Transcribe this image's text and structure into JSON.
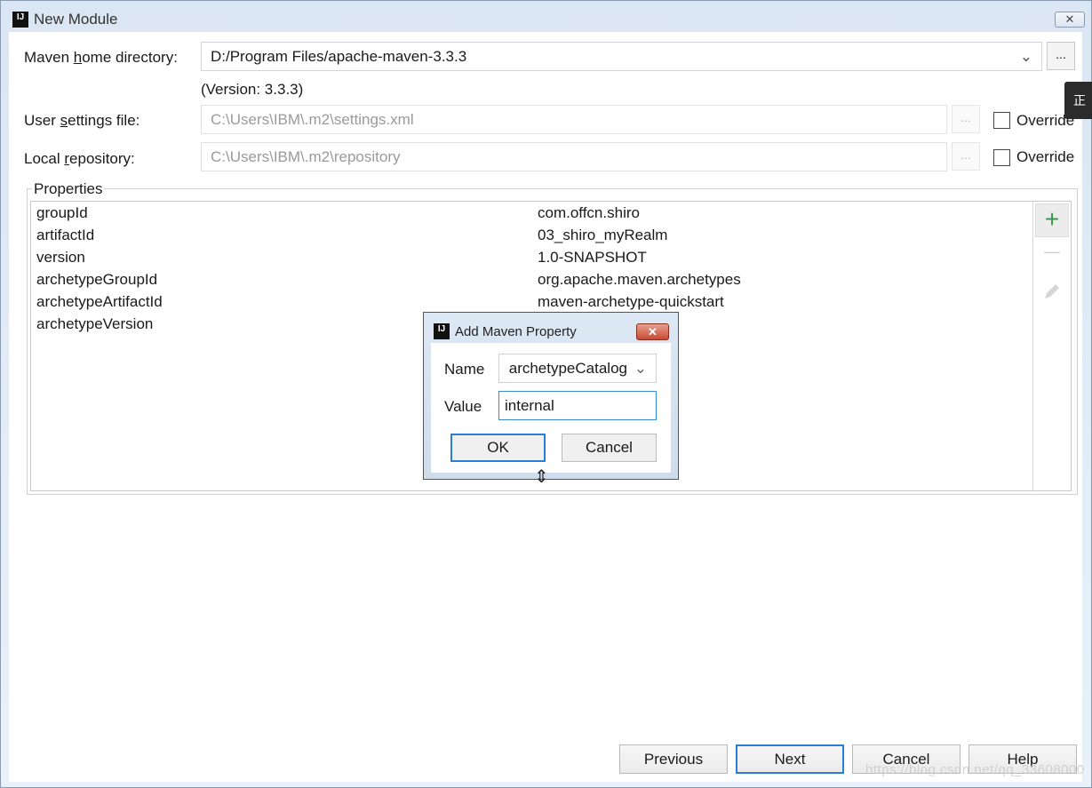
{
  "window": {
    "title": "New Module",
    "close_icon": "close-icon"
  },
  "maven": {
    "home_label_pre": "Maven ",
    "home_label_u": "h",
    "home_label_post": "ome directory:",
    "home_value": "D:/Program Files/apache-maven-3.3.3",
    "version": "(Version: 3.3.3)",
    "settings_label_pre": "User ",
    "settings_label_u": "s",
    "settings_label_post": "ettings file:",
    "settings_value": "C:\\Users\\IBM\\.m2\\settings.xml",
    "repo_label_pre": "Local ",
    "repo_label_u": "r",
    "repo_label_post": "epository:",
    "repo_value": "C:\\Users\\IBM\\.m2\\repository",
    "browse": "...",
    "override": "Override",
    "override_settings_checked": false,
    "override_repo_checked": false
  },
  "properties": {
    "title": "Properties",
    "rows": [
      {
        "name": "groupId",
        "value": "com.offcn.shiro"
      },
      {
        "name": "artifactId",
        "value": "03_shiro_myRealm"
      },
      {
        "name": "version",
        "value": "1.0-SNAPSHOT"
      },
      {
        "name": "archetypeGroupId",
        "value": "org.apache.maven.archetypes"
      },
      {
        "name": "archetypeArtifactId",
        "value": "maven-archetype-quickstart"
      },
      {
        "name": "archetypeVersion",
        "value": ""
      }
    ],
    "tools": {
      "add": "+",
      "remove": "—"
    },
    "accent": "#3c9a4a"
  },
  "dialog": {
    "title": "Add Maven Property",
    "name_label": "Name",
    "name_value": "archetypeCatalog",
    "value_label": "Value",
    "value_value": "internal",
    "ok": "OK",
    "cancel": "Cancel"
  },
  "footer": {
    "previous": "Previous",
    "next": "Next",
    "cancel": "Cancel",
    "help": "Help"
  },
  "tooltip": "正在",
  "watermark": "https://blog.csdn.net/qq_33608000"
}
